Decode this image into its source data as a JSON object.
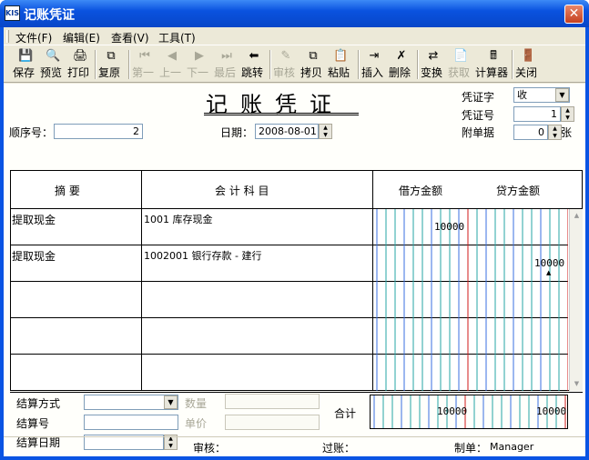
{
  "window": {
    "title": "记账凭证",
    "icon_text": "KIS"
  },
  "menu": [
    "文件(F)",
    "编辑(E)",
    "查看(V)",
    "工具(T)"
  ],
  "toolbar": [
    {
      "label": "保存",
      "icon": "save-icon",
      "glyph": "💾",
      "enabled": true
    },
    {
      "label": "预览",
      "icon": "preview-icon",
      "glyph": "🔍",
      "enabled": true
    },
    {
      "label": "打印",
      "icon": "print-icon",
      "glyph": "🖨",
      "enabled": true
    },
    {
      "label": "复原",
      "icon": "restore-icon",
      "glyph": "⧉",
      "enabled": true
    },
    {
      "label": "第一",
      "icon": "first-icon",
      "glyph": "⏮",
      "enabled": false
    },
    {
      "label": "上一",
      "icon": "prev-icon",
      "glyph": "◀",
      "enabled": false
    },
    {
      "label": "下一",
      "icon": "next-icon",
      "glyph": "▶",
      "enabled": false
    },
    {
      "label": "最后",
      "icon": "last-icon",
      "glyph": "⏭",
      "enabled": false
    },
    {
      "label": "跳转",
      "icon": "jump-icon",
      "glyph": "⬅",
      "enabled": true
    },
    {
      "label": "审核",
      "icon": "audit-icon",
      "glyph": "✎",
      "enabled": false
    },
    {
      "label": "拷贝",
      "icon": "copy-icon",
      "glyph": "⧉",
      "enabled": true
    },
    {
      "label": "粘贴",
      "icon": "paste-icon",
      "glyph": "📋",
      "enabled": true
    },
    {
      "label": "插入",
      "icon": "insert-icon",
      "glyph": "⇥",
      "enabled": true
    },
    {
      "label": "删除",
      "icon": "delete-icon",
      "glyph": "✗",
      "enabled": true
    },
    {
      "label": "变换",
      "icon": "transform-icon",
      "glyph": "⇄",
      "enabled": true
    },
    {
      "label": "获取",
      "icon": "fetch-icon",
      "glyph": "📄",
      "enabled": false
    },
    {
      "label": "计算器",
      "icon": "calculator-icon",
      "glyph": "🖩",
      "enabled": true
    },
    {
      "label": "关闭",
      "icon": "close-door-icon",
      "glyph": "🚪",
      "enabled": true
    }
  ],
  "voucher": {
    "title": "记账凭证",
    "seq_label": "顺序号：",
    "seq_value": "2",
    "date_label": "日期：",
    "date_value": "2008-08-01",
    "type_label": "凭证字",
    "type_value": "收",
    "number_label": "凭证号",
    "number_value": "1",
    "attach_label": "附单据",
    "attach_value": "0",
    "attach_unit": "张"
  },
  "grid": {
    "headers": {
      "summary": "摘    要",
      "account": "会  计  科  目",
      "debit": "借方金额",
      "credit": "贷方金额"
    },
    "rows": [
      {
        "summary": "提取现金",
        "account": "1001 库存现金",
        "debit": "10000",
        "credit": ""
      },
      {
        "summary": "提取现金",
        "account": "1002001 银行存款 - 建行",
        "debit": "",
        "credit": "10000"
      },
      {
        "summary": "",
        "account": "",
        "debit": "",
        "credit": ""
      },
      {
        "summary": "",
        "account": "",
        "debit": "",
        "credit": ""
      },
      {
        "summary": "",
        "account": "",
        "debit": "",
        "credit": ""
      }
    ]
  },
  "settlement": {
    "method_label": "结算方式",
    "method_value": "",
    "number_label": "结算号",
    "number_value": "",
    "date_label": "结算日期",
    "date_value": "",
    "qty_label": "数量",
    "price_label": "单价"
  },
  "totals": {
    "label": "合计",
    "debit": "10000",
    "credit": "10000"
  },
  "footer": {
    "audit_label": "审核：",
    "posting_label": "过账：",
    "maker_label": "制单：",
    "maker_value": "Manager"
  },
  "colors": {
    "title_bar": "#0a52df",
    "grid_blue": "#3a6fe0",
    "grid_teal": "#25a6a6",
    "grid_red": "#d21a1a"
  }
}
